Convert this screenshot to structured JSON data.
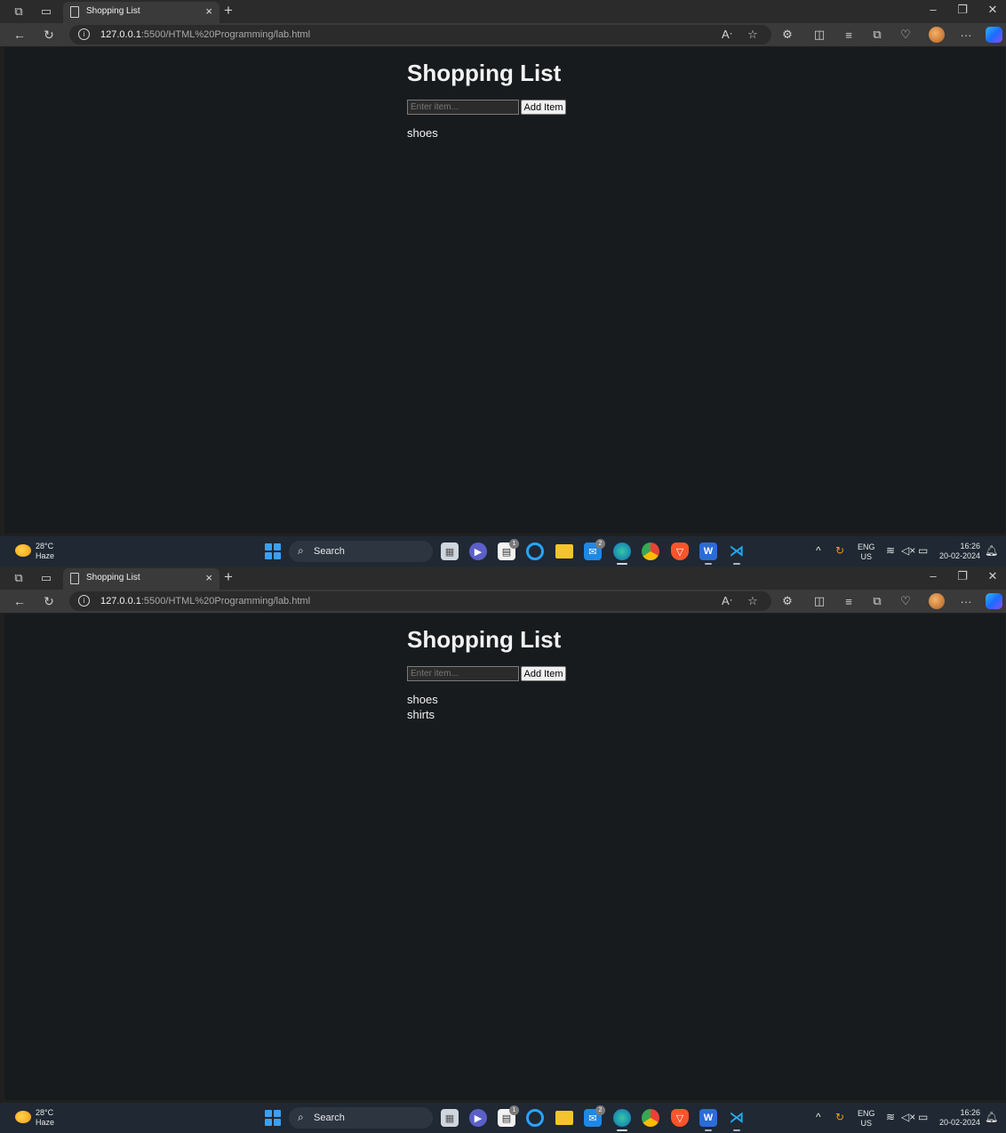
{
  "browser": {
    "tab_title": "Shopping List",
    "tab_close": "×",
    "new_tab": "+",
    "url_host": "127.0.0.1",
    "url_rest": ":5500/HTML%20Programming/lab.html",
    "more_label": "···",
    "minimize": "–",
    "restore": "❐",
    "close": "✕"
  },
  "taskbar": {
    "temperature": "28°C",
    "condition": "Haze",
    "search_label": "Search",
    "lang_top": "ENG",
    "lang_bottom": "US",
    "time": "16:26",
    "date": "20-02-2024",
    "store_badge": "1",
    "mail_badge": "2"
  },
  "screens": [
    {
      "page": {
        "heading": "Shopping List",
        "input_placeholder": "Enter item...",
        "button_label": "Add Item",
        "items": [
          "shoes"
        ]
      }
    },
    {
      "page": {
        "heading": "Shopping List",
        "input_placeholder": "Enter item...",
        "button_label": "Add Item",
        "items": [
          "shoes",
          "shirts"
        ]
      }
    }
  ]
}
